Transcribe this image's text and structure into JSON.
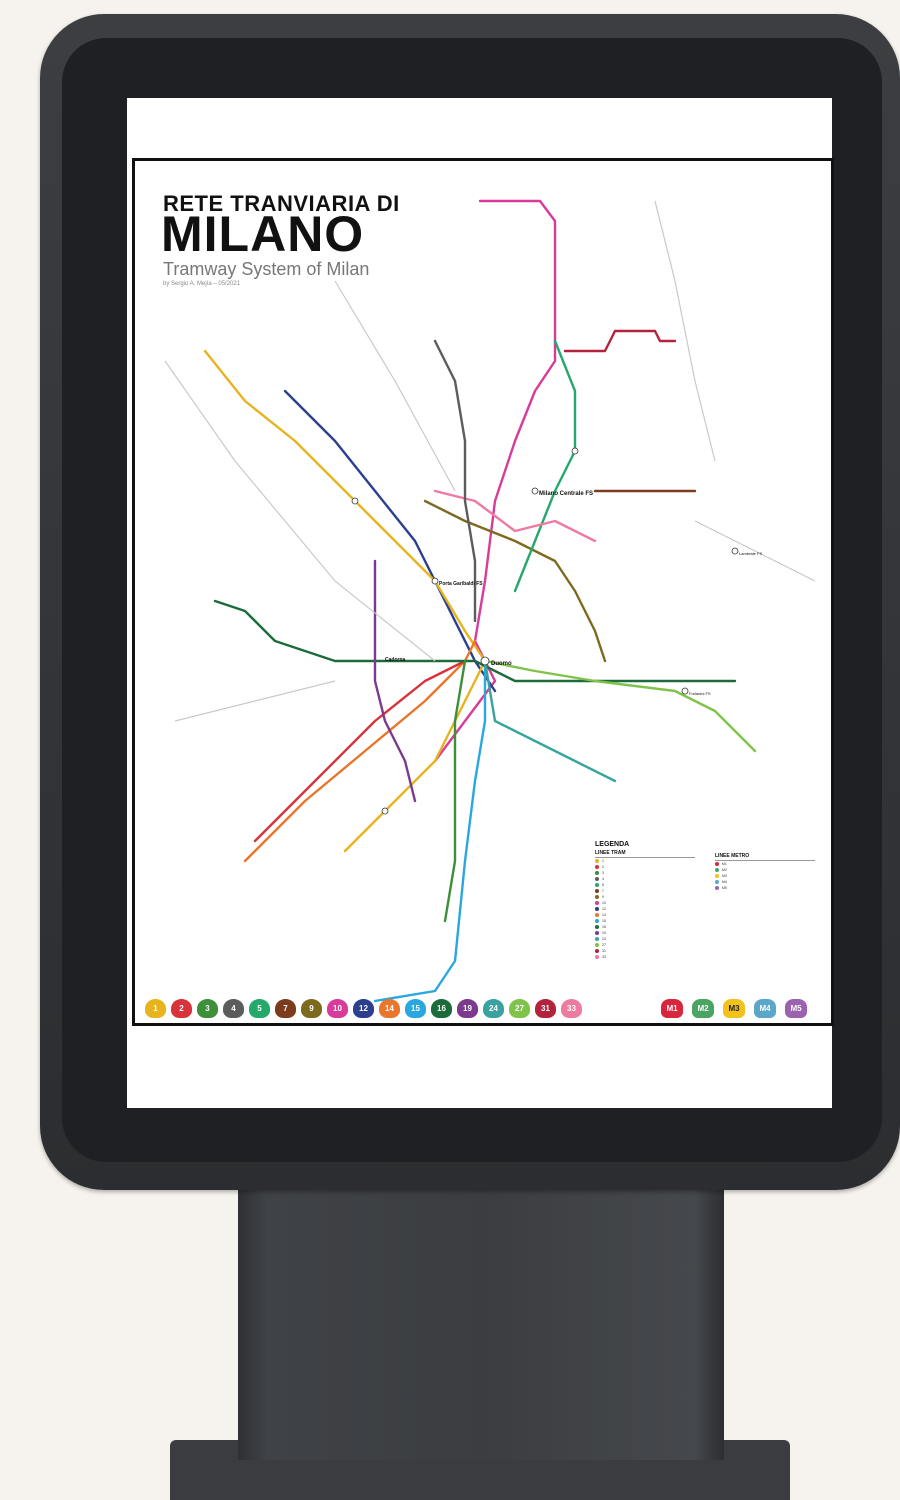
{
  "header": {
    "title_line1": "RETE TRANVIARIA DI",
    "title_line2": "MILANO",
    "subtitle": "Tramway System of Milan",
    "author": "by Sergio A. Mejía – 05/2021"
  },
  "legend": {
    "title": "LEGENDA",
    "tram_heading": "LINEE TRAM",
    "metro_heading": "LINEE METRO",
    "tram_lines": [
      "1",
      "2",
      "3",
      "4",
      "5",
      "7",
      "9",
      "10",
      "12",
      "14",
      "15",
      "16",
      "19",
      "24",
      "27",
      "31",
      "33"
    ],
    "metro_lines": [
      "M1",
      "M2",
      "M3",
      "M4",
      "M5"
    ]
  },
  "badges": [
    {
      "label": "1",
      "color": "#e8b31d"
    },
    {
      "label": "2",
      "color": "#d8323a"
    },
    {
      "label": "3",
      "color": "#3e8f3a"
    },
    {
      "label": "4",
      "color": "#5c5c5c"
    },
    {
      "label": "5",
      "color": "#25a96a"
    },
    {
      "label": "7",
      "color": "#7b3b1c"
    },
    {
      "label": "9",
      "color": "#7e6a1f"
    },
    {
      "label": "10",
      "color": "#d83b9a"
    },
    {
      "label": "12",
      "color": "#2b3f8c"
    },
    {
      "label": "14",
      "color": "#e9762a"
    },
    {
      "label": "15",
      "color": "#29a7de"
    },
    {
      "label": "16",
      "color": "#1c6b3a"
    },
    {
      "label": "19",
      "color": "#7c3a8f"
    },
    {
      "label": "24",
      "color": "#3aa3a0"
    },
    {
      "label": "27",
      "color": "#7fc34a"
    },
    {
      "label": "31",
      "color": "#b2243b"
    },
    {
      "label": "33",
      "color": "#ef7aa0"
    }
  ],
  "metro_badges": [
    {
      "label": "M1",
      "color": "#d7263d"
    },
    {
      "label": "M2",
      "color": "#4aa562"
    },
    {
      "label": "M3",
      "color": "#f2c21a"
    },
    {
      "label": "M4",
      "color": "#5aa7c9"
    },
    {
      "label": "M5",
      "color": "#9b62b0"
    }
  ],
  "stations": {
    "central": "Milano Centrale FS",
    "garibaldi": "Porta Garibaldi FS",
    "duomo": "Duomo",
    "cadorna": "Cadorna",
    "lambrate": "Lambrate FS",
    "forlanini": "Forlanini FS"
  }
}
